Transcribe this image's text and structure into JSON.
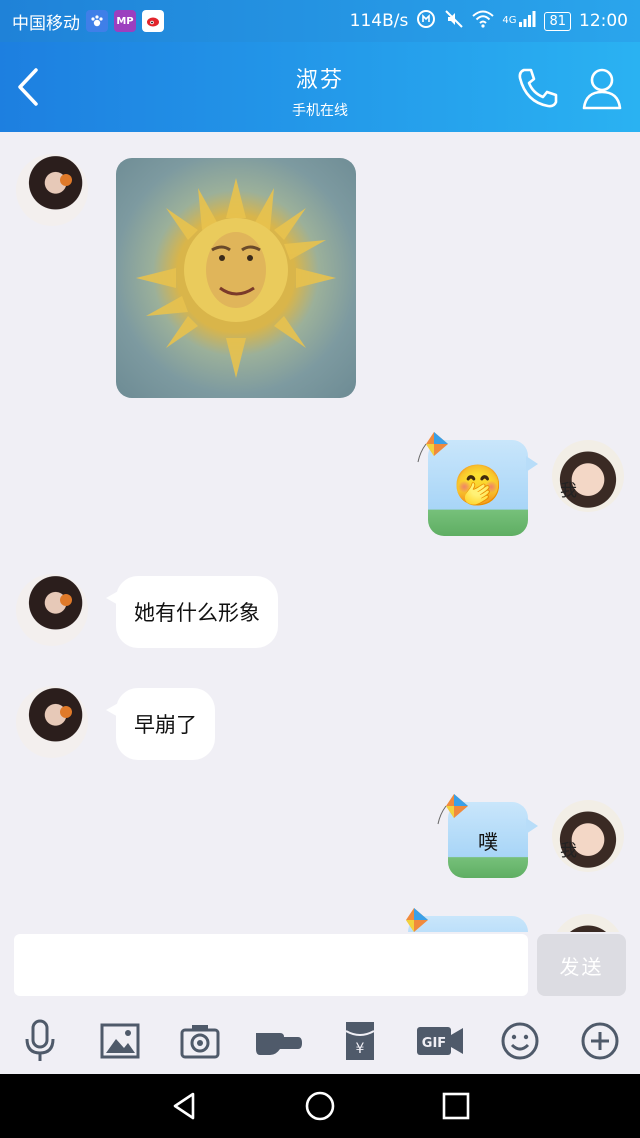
{
  "status_bar": {
    "carrier": "中国移动",
    "net_speed": "114B/s",
    "network": "4G",
    "battery": "81",
    "time": "12:00",
    "app_icons": [
      "paw-icon",
      "mp-icon",
      "weibo-icon"
    ],
    "status_icons": [
      "data-saver-icon",
      "mute-icon",
      "wifi-icon",
      "signal-icon"
    ]
  },
  "header": {
    "contact_name": "淑芬",
    "contact_status": "手机在线",
    "icons": {
      "back": "chevron-left-icon",
      "call": "phone-icon",
      "profile": "person-icon"
    }
  },
  "messages": [
    {
      "from": "her",
      "type": "image",
      "image_name": "sun-face-image"
    },
    {
      "from": "me",
      "type": "emoji",
      "emoji": "🤭"
    },
    {
      "from": "her",
      "type": "text",
      "text": "她有什么形象"
    },
    {
      "from": "her",
      "type": "text",
      "text": "早崩了"
    },
    {
      "from": "me",
      "type": "text",
      "text": "噗"
    },
    {
      "from": "me",
      "type": "partial"
    }
  ],
  "avatar_me_label": "我",
  "composer": {
    "placeholder": "",
    "value": "",
    "send_label": "发送"
  },
  "toolbar": [
    "mic-icon",
    "picture-icon",
    "camera-icon",
    "poke-hand-icon",
    "red-packet-icon",
    "gif-icon",
    "emoji-icon",
    "plus-icon"
  ],
  "nav": [
    "back-triangle-icon",
    "home-circle-icon",
    "recents-square-icon"
  ],
  "colors": {
    "header": "#1d7fe0",
    "header_end": "#2ab2f2",
    "chat_bg": "#f0eff5",
    "bubble": "#ffffff"
  }
}
